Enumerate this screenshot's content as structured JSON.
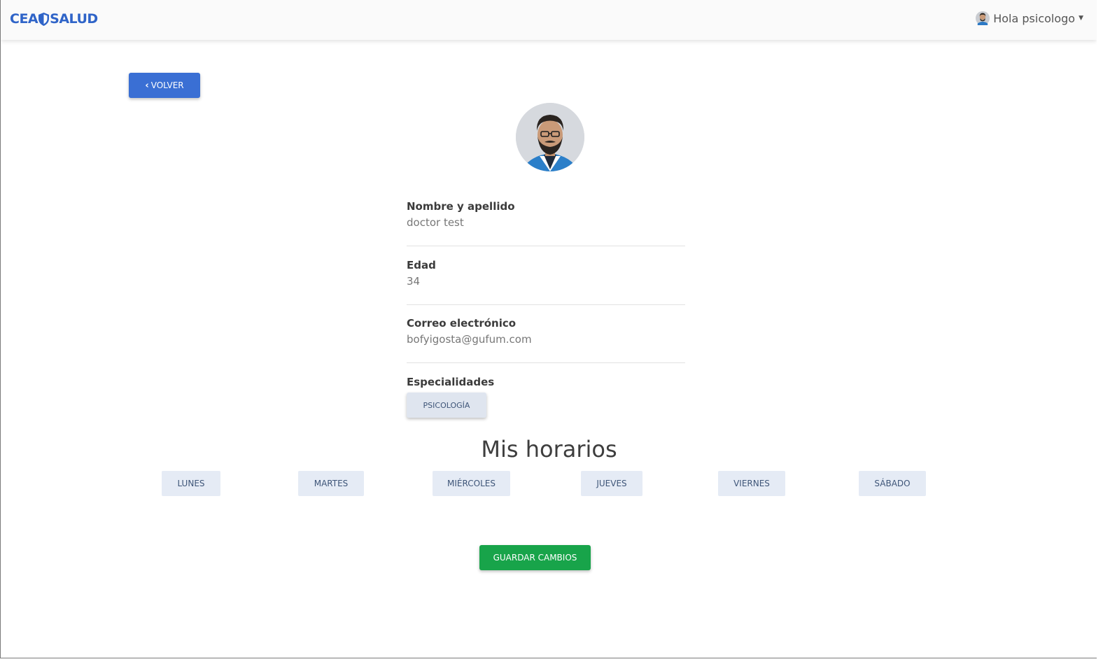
{
  "navbar": {
    "brand_left": "CEA",
    "brand_right": "SALUD",
    "brand_color": "#2f64c8",
    "user_greeting": "Hola psicologo"
  },
  "back_button": {
    "label": "VOLVER",
    "icon": "chevron-left-icon"
  },
  "profile": {
    "fields": [
      {
        "label": "Nombre y apellido",
        "value": "doctor test"
      },
      {
        "label": "Edad",
        "value": "34"
      },
      {
        "label": "Correo electrónico",
        "value": "bofyigosta@gufum.com"
      }
    ],
    "specialties_label": "Especialidades",
    "specialties": [
      "PSICOLOGÍA"
    ]
  },
  "schedule": {
    "title": "Mis horarios",
    "days": [
      "LUNES",
      "MARTES",
      "MIÉRCOLES",
      "JUEVES",
      "VIERNES",
      "SÁBADO"
    ]
  },
  "save_button": {
    "label": "GUARDAR CAMBIOS",
    "color": "#18a44a"
  }
}
